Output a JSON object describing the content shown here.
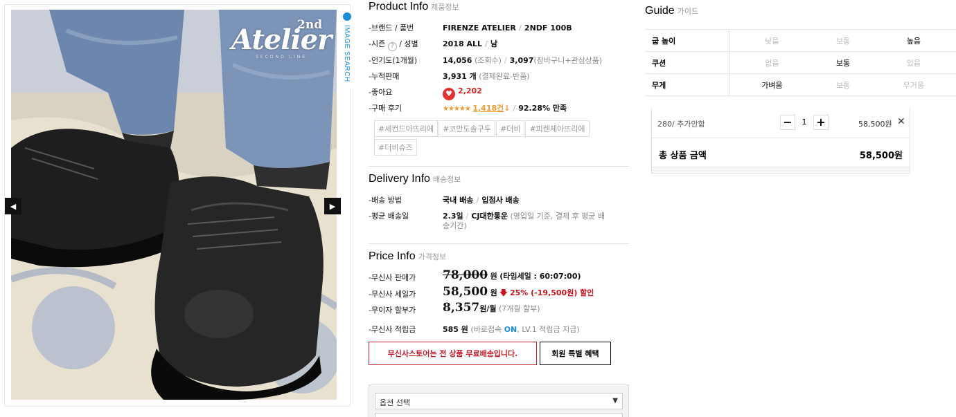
{
  "image": {
    "watermark_brand": "Atelier",
    "watermark_sup": "2nd",
    "watermark_line": "SECOND LINE",
    "search_label": "IMAGE SEARCH",
    "prev_icon": "◀",
    "next_icon": "▶"
  },
  "product": {
    "title": "Product Info",
    "title_ko": "제품정보",
    "brand_label": "-브랜드 / 품번",
    "brand": "FIRENZE ATELIER",
    "code": "2NDF 100B",
    "season_label": "-시즌",
    "help": "?",
    "gender_label": "/ 성별",
    "season": "2018 ALL",
    "gender": "남",
    "pop_label": "-인기도(1개월)",
    "views": "14,056",
    "views_sub": "(조회수)",
    "carts": "3,097",
    "carts_sub": "(장바구니+관심상품)",
    "sales_label": "-누적판매",
    "sales": "3,931 개",
    "sales_sub": "(결제완료-반품)",
    "like_label": "-좋아요",
    "heart_icon": "♥",
    "likes": "2,202",
    "review_label": "-구매 후기",
    "stars": "★★★★★",
    "reviews": "1,418건",
    "review_arrow": "↓",
    "satisfaction": "92.28% 만족",
    "tags": [
      "#세컨드아뜨리에",
      "#코만도솔구두",
      "#더비",
      "#피렌체아뜨리에",
      "#더비슈즈"
    ]
  },
  "delivery": {
    "title": "Delivery Info",
    "title_ko": "배송정보",
    "method_label": "-배송 방법",
    "method1": "국내 배송",
    "method2": "입점사 배송",
    "avg_label": "-평균 배송일",
    "avg": "2.3일",
    "courier": "CJ대한통운",
    "note1": "(영업일 기준, 결제 후 평균 배",
    "note2": "송기간)"
  },
  "price": {
    "title": "Price Info",
    "title_ko": "가격정보",
    "list_label": "-무신사 판매가",
    "list_price": "78,000",
    "won": "원",
    "timesale": "(타임세일 : 60:07:00)",
    "sale_label": "-무신사 세일가",
    "sale_price": "58,500",
    "down_icon": "🡇",
    "discount": "25% (-19,500원) 할인",
    "inst_label": "-무이자 할부가",
    "inst_price": "8,357",
    "inst_unit": "원/월",
    "inst_note": "(7개월 할부)",
    "point_label": "-무신사 적립금",
    "points": "585 원",
    "point_note1": "(바로접속",
    "point_on": "ON",
    "point_note2": ", LV.1 적립금 지급)",
    "free_ship_btn": "무신사스토어는 전 상품 무료배송입니다.",
    "member_btn": "회원 특별 혜택",
    "option_placeholder": "옵션 선택",
    "option_caret": "▼"
  },
  "guide": {
    "title": "Guide",
    "title_ko": "가이드",
    "rows": [
      {
        "label": "굽 높이",
        "opts": [
          "낮음",
          "보통",
          "높음"
        ],
        "selected": 2
      },
      {
        "label": "쿠션",
        "opts": [
          "없음",
          "보통",
          "있음"
        ],
        "selected": 1
      },
      {
        "label": "무게",
        "opts": [
          "가벼움",
          "보통",
          "무거움"
        ],
        "selected": 0
      }
    ]
  },
  "cart": {
    "item_name": "280/ 추가안함",
    "minus": "−",
    "qty": "1",
    "plus": "+",
    "item_price": "58,500원",
    "remove_icon": "✕",
    "total_label": "총 상품 금액",
    "total_value": "58,500원"
  }
}
